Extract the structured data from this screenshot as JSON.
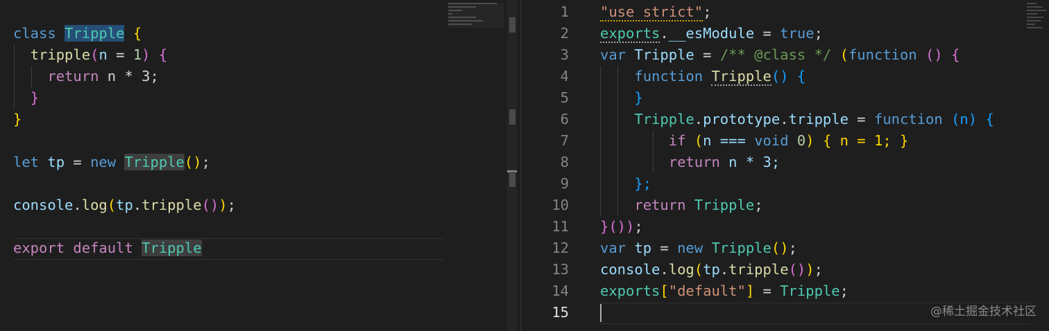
{
  "left_editor": {
    "code": {
      "l1_class": "class",
      "l1_name": "Tripple",
      "l1_brace": "{",
      "l2_method": "tripple",
      "l2_paren_open": "(",
      "l2_param": "n",
      "l2_eq": " = ",
      "l2_default": "1",
      "l2_paren_close": ")",
      "l2_brace": "{",
      "l3_return": "return",
      "l3_expr": " n * 3;",
      "l4_brace": "}",
      "l5_brace": "}",
      "l7_let": "let",
      "l7_var": " tp",
      "l7_eq": " = ",
      "l7_new": "new",
      "l7_cls": "Tripple",
      "l7_call": "()",
      "l7_semi": ";",
      "l9_console": "console",
      "l9_dot": ".",
      "l9_log": "log",
      "l9_p1": "(",
      "l9_tp": "tp",
      "l9_dot2": ".",
      "l9_method": "tripple",
      "l9_p2": "()",
      "l9_p3": ")",
      "l9_semi": ";",
      "l11_export": "export",
      "l11_default": " default ",
      "l11_cls": "Tripple"
    }
  },
  "right_editor": {
    "line_numbers": [
      "1",
      "2",
      "3",
      "4",
      "5",
      "6",
      "7",
      "8",
      "9",
      "10",
      "11",
      "12",
      "13",
      "14",
      "15"
    ],
    "active_line": "15",
    "code": {
      "r1_str": "\"use strict\"",
      "r1_semi": ";",
      "r2_exports": "exports",
      "r2_dot": ".",
      "r2_prop": "__esModule",
      "r2_eq": " = ",
      "r2_true": "true",
      "r2_semi": ";",
      "r3_var": "var",
      "r3_name": " Tripple",
      "r3_eq": " = ",
      "r3_cmt": "/** @class */",
      "r3_p1": "(",
      "r3_function": "function",
      "r3_p2": "()",
      "r3_brace": "{",
      "r4_function": "function",
      "r4_name": "Tripple",
      "r4_parens": "()",
      "r4_brace": "{",
      "r5_brace": "}",
      "r6_cls": "Tripple",
      "r6_dot": ".",
      "r6_proto": "prototype",
      "r6_dot2": ".",
      "r6_method": "tripple",
      "r6_eq": " = ",
      "r6_function": "function",
      "r6_paren": "(n)",
      "r6_brace": "{",
      "r7_if": "if",
      "r7_cond_open": "(",
      "r7_cond": "n === ",
      "r7_void": "void",
      "r7_zero": " 0",
      "r7_cond_close": ")",
      "r7_body": "{ n = 1; }",
      "r8_return": "return",
      "r8_expr": " n * 3;",
      "r9_close": "};",
      "r10_return": "return",
      "r10_name": " Tripple",
      "r10_semi": ";",
      "r11_close": "}())",
      "r11_semi": ";",
      "r12_var": "var",
      "r12_tp": " tp",
      "r12_eq": " = ",
      "r12_new": "new",
      "r12_cls": "Tripple",
      "r12_call": "()",
      "r12_semi": ";",
      "r13_console": "console",
      "r13_dot": ".",
      "r13_log": "log",
      "r13_p1": "(",
      "r13_tp": "tp",
      "r13_dot2": ".",
      "r13_method": "tripple",
      "r13_p2": "()",
      "r13_p3": ")",
      "r13_semi": ";",
      "r14_exports": "exports",
      "r14_bracket_open": "[",
      "r14_str": "\"default\"",
      "r14_bracket_close": "]",
      "r14_eq": " = ",
      "r14_cls": "Tripple",
      "r14_semi": ";"
    }
  },
  "watermark": "@稀土掘金技术社区"
}
